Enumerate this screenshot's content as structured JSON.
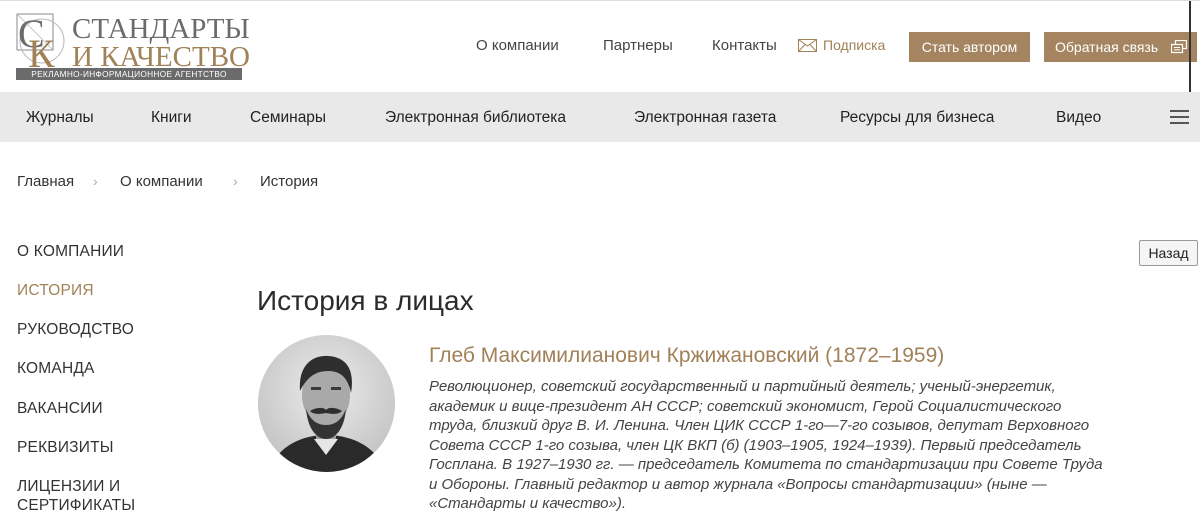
{
  "header": {
    "logo_line1": "СТАНДАРТЫ",
    "logo_line2": "И КАЧЕСТВО",
    "logo_tagline": "РЕКЛАМНО-ИНФОРМАЦИОННОЕ АГЕНТСТВО",
    "top_links": [
      "О компании",
      "Партнеры",
      "Контакты"
    ],
    "subscribe_label": "Подписка",
    "author_button": "Стать автором",
    "feedback_button": "Обратная связь"
  },
  "main_nav": {
    "items": [
      "Журналы",
      "Книги",
      "Семинары",
      "Электронная библиотека",
      "Электронная газета",
      "Ресурсы для бизнеса",
      "Видео"
    ]
  },
  "breadcrumb": [
    "Главная",
    "О компании",
    "История"
  ],
  "sidebar": {
    "items": [
      "О КОМПАНИИ",
      "ИСТОРИЯ",
      "РУКОВОДСТВО",
      "КОМАНДА",
      "ВАКАНСИИ",
      "РЕКВИЗИТЫ",
      "ЛИЦЕНЗИИ И",
      "СЕРТИФИКАТЫ"
    ],
    "active_index": 1
  },
  "back_button": "Назад",
  "content": {
    "title": "История в лицах",
    "person": {
      "name": "Глеб Максимилианович Кржижановский (1872–1959)",
      "bio_lines": [
        "Революционер, советский государственный и партийный деятель; ученый-энергетик,",
        "академик и вице-президент АН СССР; советский экономист, Герой Социалистического",
        "труда, близкий друг В. И. Ленина. Член ЦИК СССР 1-го—7-го созывов, депутат Верховного",
        "Совета СССР 1-го созыва, член ЦК ВКП (б) (1903–1905, 1924–1939). Первый председатель",
        "Госплана. В 1927–1930 гг. — председатель Комитета по стандартизации при Совете Труда",
        "и Обороны. Главный редактор и автор журнала «Вопросы стандартизации» (ныне —",
        "«Стандарты и качество»)."
      ]
    }
  },
  "colors": {
    "accent": "#a08158",
    "button_bg": "#a58561",
    "nav_bg": "#e9e9e9"
  }
}
